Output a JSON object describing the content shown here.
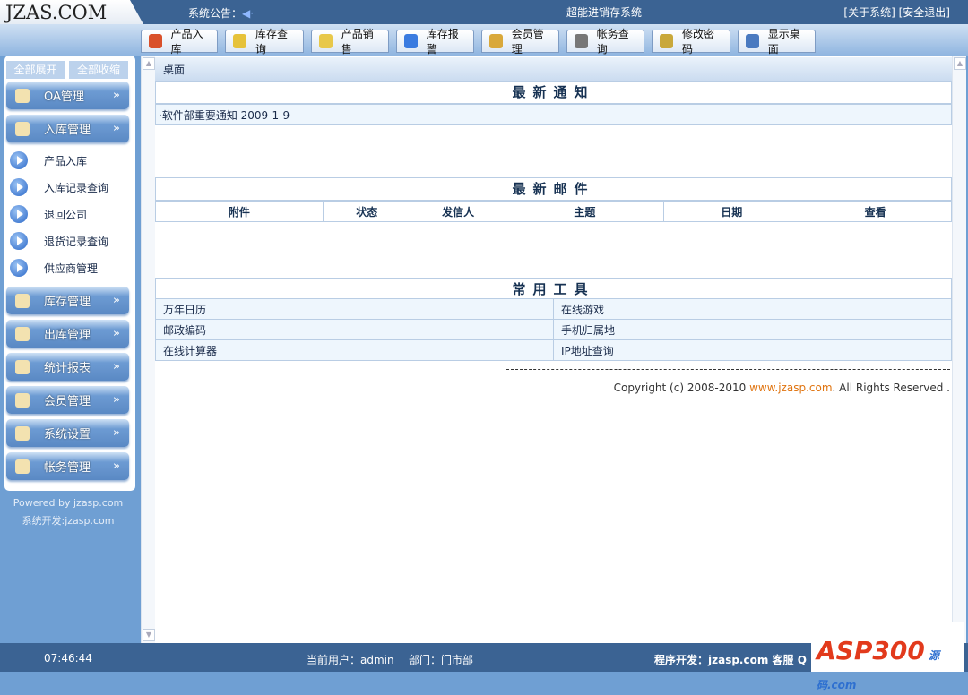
{
  "header": {
    "logo": "JZAS.COM",
    "notice_label": "系统公告：",
    "system_title": "超能进销存系统",
    "links": [
      "[关于系统]",
      "[安全退出]"
    ]
  },
  "toolbar": [
    {
      "label": "产品入库",
      "icon": "house-icon",
      "color": "#d9502a"
    },
    {
      "label": "库存查询",
      "icon": "book-icon",
      "color": "#e6c23a"
    },
    {
      "label": "产品销售",
      "icon": "tag-icon",
      "color": "#e8c84a"
    },
    {
      "label": "库存报警",
      "icon": "speaker-icon",
      "color": "#3a7be0"
    },
    {
      "label": "会员管理",
      "icon": "member-icon",
      "color": "#d9a83a"
    },
    {
      "label": "帐务查询",
      "icon": "clipboard-icon",
      "color": "#777"
    },
    {
      "label": "修改密码",
      "icon": "keys-icon",
      "color": "#c9a83a"
    },
    {
      "label": "显示桌面",
      "icon": "desktop-icon",
      "color": "#4a7ac0"
    }
  ],
  "sidebar": {
    "expand_all": "全部展开",
    "collapse_all": "全部收缩",
    "menus": [
      {
        "label": "OA管理",
        "icon": "hand-house-icon"
      },
      {
        "label": "入库管理",
        "icon": "inbound-icon"
      },
      {
        "label": "库存管理",
        "icon": "boxes-icon"
      },
      {
        "label": "出库管理",
        "icon": "outbound-icon"
      },
      {
        "label": "统计报表",
        "icon": "report-icon"
      },
      {
        "label": "会员管理",
        "icon": "smiley-icon"
      },
      {
        "label": "系统设置",
        "icon": "globe-icon"
      },
      {
        "label": "帐务管理",
        "icon": "pen-icon"
      }
    ],
    "chevron": "»",
    "submenu": [
      "产品入库",
      "入库记录查询",
      "退回公司",
      "退货记录查询",
      "供应商管理"
    ],
    "powered": "Powered by jzasp.com",
    "developer": "系统开发:jzasp.com"
  },
  "main": {
    "breadcrumb": "桌面",
    "notice_title": "最新通知",
    "notice_item": "·软件部重要通知 2009-1-9",
    "mail_title": "最新邮件",
    "mail_columns": [
      "附件",
      "状态",
      "发信人",
      "主题",
      "日期",
      "查看"
    ],
    "tools_title": "常用工具",
    "tools": [
      [
        "万年日历",
        "在线游戏"
      ],
      [
        "邮政编码",
        "手机归属地"
      ],
      [
        "在线计算器",
        "IP地址查询"
      ]
    ],
    "copyright_pre": "Copyright (c) 2008-2010 ",
    "copyright_link": "www.jzasp.com",
    "copyright_post": ". All Rights Reserved ."
  },
  "footer": {
    "time": "07:46:44",
    "user": "当前用户：admin",
    "dept": "部门：门市部",
    "dev": "程序开发：jzasp.com 客服 Q"
  },
  "watermark": "ASP300 源码 .com"
}
